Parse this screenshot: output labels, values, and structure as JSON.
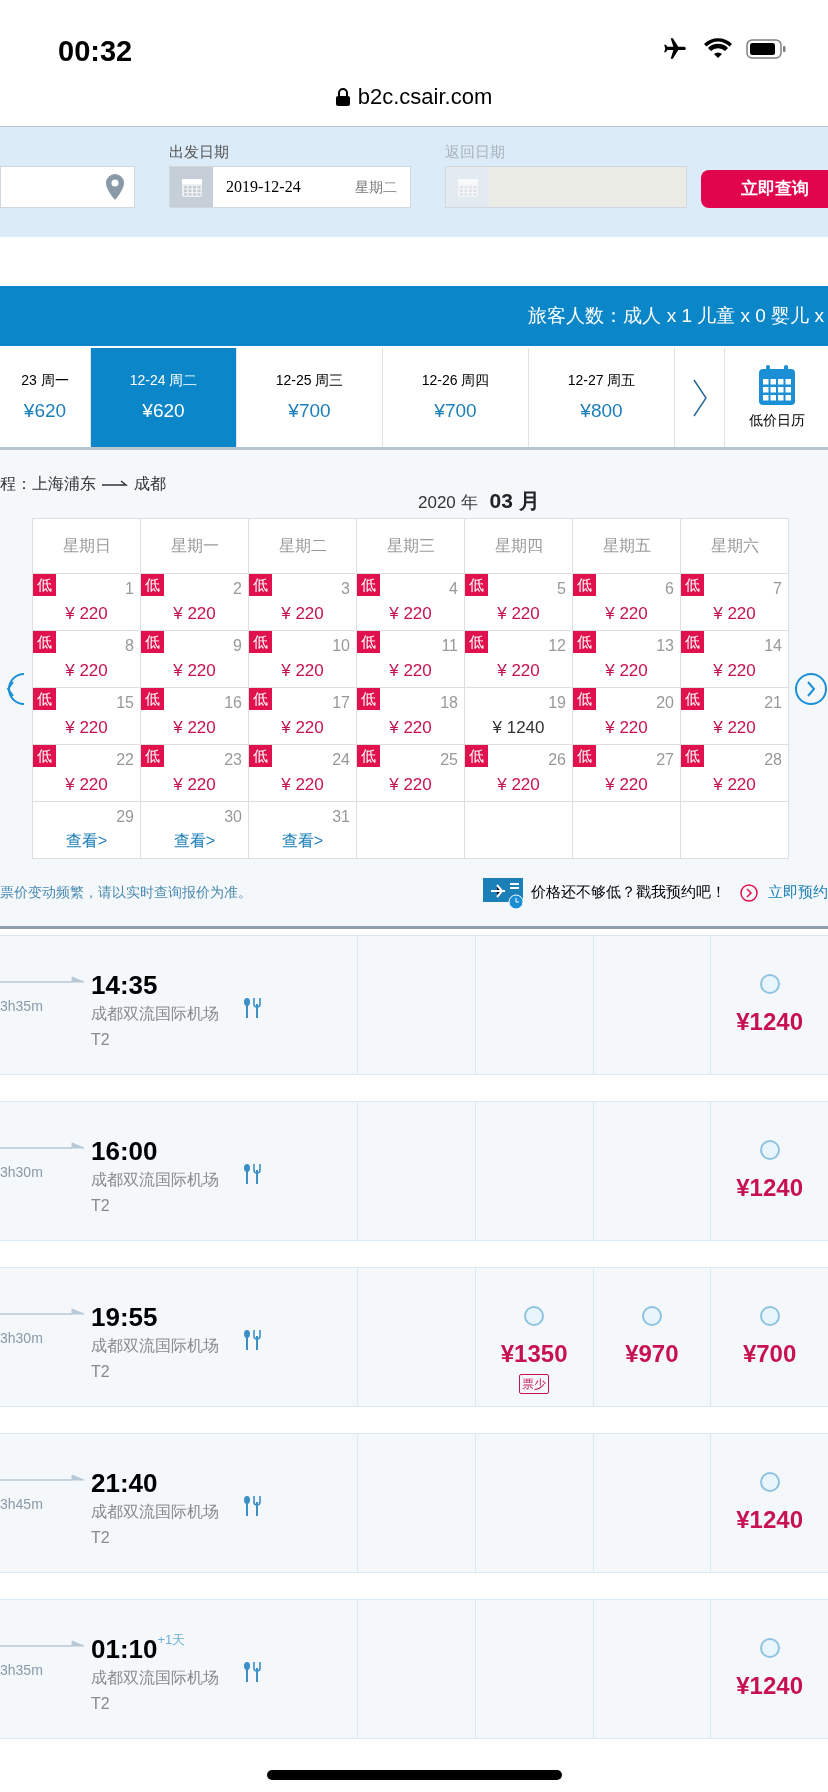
{
  "status_bar": {
    "time": "00:32"
  },
  "address_bar": {
    "url": "b2c.csair.com"
  },
  "search": {
    "depart_label": "出发日期",
    "depart_date": "2019-12-24",
    "depart_weekday": "星期二",
    "return_label": "返回日期",
    "search_button": "立即查询"
  },
  "passenger_bar": {
    "text": "旅客人数：成人 x 1 儿童 x 0 婴儿 x"
  },
  "date_tabs": [
    {
      "date": "23 周一",
      "price": "¥620",
      "selected": false
    },
    {
      "date": "12-24 周二",
      "price": "¥620",
      "selected": true
    },
    {
      "date": "12-25 周三",
      "price": "¥700",
      "selected": false
    },
    {
      "date": "12-26 周四",
      "price": "¥700",
      "selected": false
    },
    {
      "date": "12-27 周五",
      "price": "¥800",
      "selected": false
    }
  ],
  "low_price_calendar_label": "低价日历",
  "route": {
    "from": "程：上海浦东",
    "to": "成都"
  },
  "month": {
    "year": "2020 年",
    "month": "03 月"
  },
  "calendar": {
    "weekdays": [
      "星期日",
      "星期一",
      "星期二",
      "星期三",
      "星期四",
      "星期五",
      "星期六"
    ],
    "cells": [
      {
        "kind": "low",
        "tag": "低",
        "day": "1",
        "price": "¥ 220"
      },
      {
        "kind": "low",
        "tag": "低",
        "day": "2",
        "price": "¥ 220"
      },
      {
        "kind": "low",
        "tag": "低",
        "day": "3",
        "price": "¥ 220"
      },
      {
        "kind": "low",
        "tag": "低",
        "day": "4",
        "price": "¥ 220"
      },
      {
        "kind": "low",
        "tag": "低",
        "day": "5",
        "price": "¥ 220"
      },
      {
        "kind": "low",
        "tag": "低",
        "day": "6",
        "price": "¥ 220"
      },
      {
        "kind": "low",
        "tag": "低",
        "day": "7",
        "price": "¥ 220"
      },
      {
        "kind": "low",
        "tag": "低",
        "day": "8",
        "price": "¥ 220"
      },
      {
        "kind": "low",
        "tag": "低",
        "day": "9",
        "price": "¥ 220"
      },
      {
        "kind": "low",
        "tag": "低",
        "day": "10",
        "price": "¥ 220"
      },
      {
        "kind": "low",
        "tag": "低",
        "day": "11",
        "price": "¥ 220"
      },
      {
        "kind": "low",
        "tag": "低",
        "day": "12",
        "price": "¥ 220"
      },
      {
        "kind": "low",
        "tag": "低",
        "day": "13",
        "price": "¥ 220"
      },
      {
        "kind": "low",
        "tag": "低",
        "day": "14",
        "price": "¥ 220"
      },
      {
        "kind": "low",
        "tag": "低",
        "day": "15",
        "price": "¥ 220"
      },
      {
        "kind": "low",
        "tag": "低",
        "day": "16",
        "price": "¥ 220"
      },
      {
        "kind": "low",
        "tag": "低",
        "day": "17",
        "price": "¥ 220"
      },
      {
        "kind": "low",
        "tag": "低",
        "day": "18",
        "price": "¥ 220"
      },
      {
        "kind": "normal",
        "day": "19",
        "price": "¥ 1240"
      },
      {
        "kind": "low",
        "tag": "低",
        "day": "20",
        "price": "¥ 220"
      },
      {
        "kind": "low",
        "tag": "低",
        "day": "21",
        "price": "¥ 220"
      },
      {
        "kind": "low",
        "tag": "低",
        "day": "22",
        "price": "¥ 220"
      },
      {
        "kind": "low",
        "tag": "低",
        "day": "23",
        "price": "¥ 220"
      },
      {
        "kind": "low",
        "tag": "低",
        "day": "24",
        "price": "¥ 220"
      },
      {
        "kind": "low",
        "tag": "低",
        "day": "25",
        "price": "¥ 220"
      },
      {
        "kind": "low",
        "tag": "低",
        "day": "26",
        "price": "¥ 220"
      },
      {
        "kind": "low",
        "tag": "低",
        "day": "27",
        "price": "¥ 220"
      },
      {
        "kind": "low",
        "tag": "低",
        "day": "28",
        "price": "¥ 220"
      },
      {
        "kind": "view",
        "day": "29",
        "link": "查看>"
      },
      {
        "kind": "view",
        "day": "30",
        "link": "查看>"
      },
      {
        "kind": "view",
        "day": "31",
        "link": "查看>"
      },
      {
        "kind": "empty"
      },
      {
        "kind": "empty"
      },
      {
        "kind": "empty"
      },
      {
        "kind": "empty"
      }
    ]
  },
  "notice": {
    "text": "票价变动频繁，请以实时查询报价为准。",
    "promo": "价格还不够低？戳我预约吧！",
    "promo_link": "立即预约"
  },
  "flights": [
    {
      "duration": "3h35m",
      "arrive": "14:35",
      "airport": "成都双流国际机场",
      "terminal": "T2",
      "fares": [
        {
          "kind": "empty"
        },
        {
          "kind": "empty"
        },
        {
          "kind": "empty"
        },
        {
          "kind": "fare",
          "price": "¥1240",
          "selected": false
        }
      ]
    },
    {
      "duration": "3h30m",
      "arrive": "16:00",
      "airport": "成都双流国际机场",
      "terminal": "T2",
      "fares": [
        {
          "kind": "empty"
        },
        {
          "kind": "empty"
        },
        {
          "kind": "empty"
        },
        {
          "kind": "fare",
          "price": "¥1240",
          "selected": false
        }
      ]
    },
    {
      "duration": "3h30m",
      "arrive": "19:55",
      "airport": "成都双流国际机场",
      "terminal": "T2",
      "fares": [
        {
          "kind": "empty"
        },
        {
          "kind": "fare",
          "price": "¥1350",
          "tag": "票少",
          "selected": false
        },
        {
          "kind": "fare",
          "price": "¥970",
          "selected": false
        },
        {
          "kind": "fare",
          "price": "¥700",
          "selected": false
        }
      ]
    },
    {
      "duration": "3h45m",
      "arrive": "21:40",
      "airport": "成都双流国际机场",
      "terminal": "T2",
      "fares": [
        {
          "kind": "empty"
        },
        {
          "kind": "empty"
        },
        {
          "kind": "empty"
        },
        {
          "kind": "fare",
          "price": "¥1240",
          "selected": false
        }
      ]
    },
    {
      "duration": "3h35m",
      "arrive": "01:10",
      "next_day": "+1天",
      "airport": "成都双流国际机场",
      "terminal": "T2",
      "fares": [
        {
          "kind": "empty"
        },
        {
          "kind": "empty"
        },
        {
          "kind": "empty"
        },
        {
          "kind": "fare",
          "price": "¥1240",
          "selected": false
        }
      ]
    }
  ]
}
